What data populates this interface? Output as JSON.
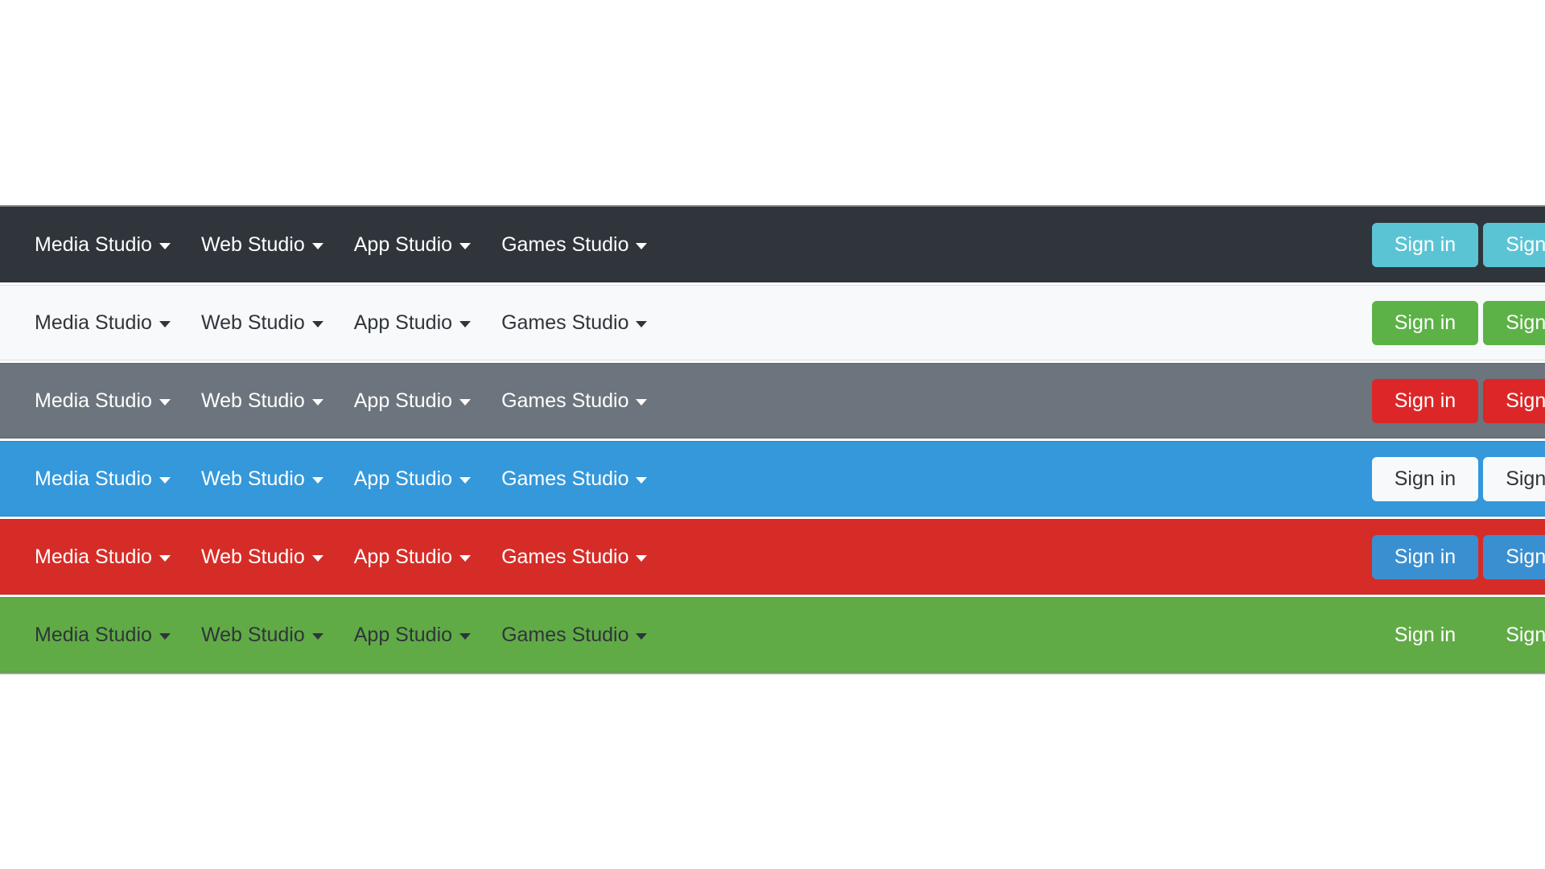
{
  "page": {
    "background": "#ffffff"
  },
  "nav_items": [
    {
      "label": "Media Studio",
      "caret": "chevron-down-icon"
    },
    {
      "label": "Web Studio",
      "caret": "chevron-down-icon"
    },
    {
      "label": "App Studio",
      "caret": "chevron-down-icon"
    },
    {
      "label": "Games Studio",
      "caret": "chevron-down-icon"
    }
  ],
  "actions": {
    "sign_in": "Sign in",
    "sign_up": "Sign up"
  },
  "navbars": [
    {
      "variant": "dark",
      "bar_color": "#2f353b",
      "text_style": "light",
      "button_style": "info",
      "button_color": "#5bc4d4",
      "items": [
        {
          "label": "Media Studio"
        },
        {
          "label": "Web Studio"
        },
        {
          "label": "App Studio"
        },
        {
          "label": "Games Studio"
        }
      ],
      "sign_in": "Sign in",
      "sign_up": "Sign up"
    },
    {
      "variant": "light",
      "bar_color": "#f7f9fa",
      "text_style": "dark",
      "button_style": "success",
      "button_color": "#5cb246",
      "items": [
        {
          "label": "Media Studio"
        },
        {
          "label": "Web Studio"
        },
        {
          "label": "App Studio"
        },
        {
          "label": "Games Studio"
        }
      ],
      "sign_in": "Sign in",
      "sign_up": "Sign up"
    },
    {
      "variant": "secondary",
      "bar_color": "#6c757d",
      "text_style": "light",
      "button_style": "danger",
      "button_color": "#dc2628",
      "items": [
        {
          "label": "Media Studio"
        },
        {
          "label": "Web Studio"
        },
        {
          "label": "App Studio"
        },
        {
          "label": "Games Studio"
        }
      ],
      "sign_in": "Sign in",
      "sign_up": "Sign up"
    },
    {
      "variant": "primary",
      "bar_color": "#3498db",
      "text_style": "light",
      "button_style": "white",
      "button_color": "#f8f9fa",
      "items": [
        {
          "label": "Media Studio"
        },
        {
          "label": "Web Studio"
        },
        {
          "label": "App Studio"
        },
        {
          "label": "Games Studio"
        }
      ],
      "sign_in": "Sign in",
      "sign_up": "Sign up"
    },
    {
      "variant": "danger",
      "bar_color": "#d62c27",
      "text_style": "light",
      "button_style": "primary",
      "button_color": "#3a8fd0",
      "items": [
        {
          "label": "Media Studio"
        },
        {
          "label": "Web Studio"
        },
        {
          "label": "App Studio"
        },
        {
          "label": "Games Studio"
        }
      ],
      "sign_in": "Sign in",
      "sign_up": "Sign up"
    },
    {
      "variant": "success",
      "bar_color": "#61ab46",
      "text_style": "dark",
      "button_style": "link",
      "button_color": "#ffffff",
      "items": [
        {
          "label": "Media Studio"
        },
        {
          "label": "Web Studio"
        },
        {
          "label": "App Studio"
        },
        {
          "label": "Games Studio"
        }
      ],
      "sign_in": "Sign in",
      "sign_up": "Sign up"
    }
  ]
}
